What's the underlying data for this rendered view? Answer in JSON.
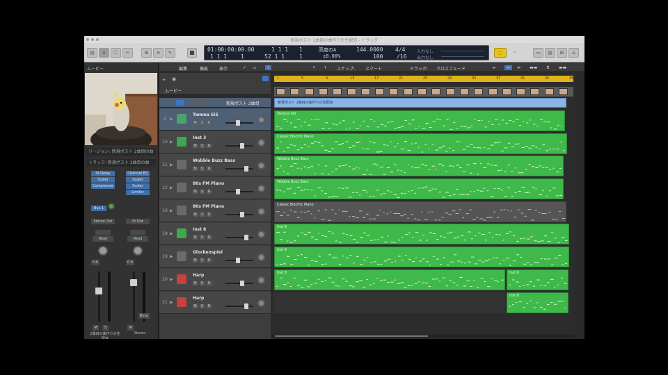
{
  "window": {
    "title": "新規ポスト 2曲目の曲作りの生配信 - トラック"
  },
  "control_bar": {
    "left_buttons": [
      "▤",
      "⬇",
      "ⓘ",
      "✂",
      "⊞",
      "≡",
      "✎"
    ],
    "right_buttons": [
      "▭",
      "▤",
      "⊞",
      "⌂"
    ],
    "lcd": {
      "smpte": "01:00:00:00.00",
      "bars_beats": "1 1 1",
      "bars_beats_tick": "1",
      "position_row2": "1 1 1",
      "position_row2_b": "1",
      "end_row2": "52 1 1",
      "end_row2_b": "1",
      "key_label": "高度のA",
      "key_value": "±0.00%",
      "tempo": "144.0000",
      "tempo_row2": "100",
      "signature": "4/4",
      "division": "/16",
      "input_label": "入力なし",
      "output_label": "出力なし"
    },
    "cycle_icon": "cycle-icon"
  },
  "inspector": {
    "header": "ムービー",
    "region_row": "リージョン: 新規ポスト 2曲目の曲",
    "track_row": "トラック: 新規ポスト 2曲目の曲",
    "strip_left": {
      "slots": [
        "St-Delay",
        "Scaler",
        "Compressor"
      ],
      "send": "Bus 1",
      "output": "Stereo Out",
      "mode": "Read",
      "db": "0.0",
      "name": "2曲目の曲作りの生配信"
    },
    "strip_right": {
      "slots": [
        "Channel EQ",
        "Scaler",
        "Scaler",
        "Limiter"
      ],
      "output": "St Out",
      "mode": "Read",
      "db": "0.0",
      "bounce": "Bnce",
      "name": "Stereo"
    }
  },
  "toolbar": {
    "items": [
      "編集",
      "機能",
      "表示"
    ],
    "snap_label": "スナップ:",
    "snap_value": "スマート",
    "drag_label": "ドラッグ:",
    "drag_value": "クロスフェード"
  },
  "global_tracks": {
    "label": "ムービー",
    "row_name": "新規ポスト 2曲目"
  },
  "tracks": [
    {
      "num": "2",
      "name": "Tamma SiS",
      "color": "#4aa36b",
      "selected": true
    },
    {
      "num": "10",
      "name": "Inst 3",
      "color": "#3fa84d",
      "selected": false
    },
    {
      "num": "11",
      "name": "Wobble Buzz Bass",
      "color": "#6a6a6a",
      "selected": false
    },
    {
      "num": "12",
      "name": "80s FM Piano",
      "color": "#6a6a6a",
      "selected": false
    },
    {
      "num": "16",
      "name": "80s FM Piano",
      "color": "#6a6a6a",
      "selected": false
    },
    {
      "num": "18",
      "name": "Inst 8",
      "color": "#3fa84d",
      "selected": false
    },
    {
      "num": "19",
      "name": "Glockenspiel",
      "color": "#6a6a6a",
      "selected": false
    },
    {
      "num": "20",
      "name": "Harp",
      "color": "#c84040",
      "selected": false
    },
    {
      "num": "21",
      "name": "Harp",
      "color": "#c84040",
      "selected": false
    }
  ],
  "ruler": {
    "ticks": [
      "1",
      "5",
      "9",
      "13",
      "17",
      "21",
      "25",
      "29",
      "33",
      "37",
      "41",
      "45",
      "49"
    ]
  },
  "video_region": {
    "label": "新規ポスト 2曲目の曲作りの生配信"
  },
  "regions": [
    {
      "name": "Tamma SiS"
    },
    {
      "name": "Classic Electric Piano"
    },
    {
      "name": "Wobble Buzz Bass"
    },
    {
      "name": "Wobble Buzz Bass"
    },
    {
      "name": "Classic Electric Piano"
    },
    {
      "name": "Inst 8"
    },
    {
      "name": "Inst 8"
    },
    {
      "name": "Inst 8"
    },
    {
      "name": "Inst 8"
    },
    {
      "name": "Inst 8"
    }
  ],
  "colors": {
    "region_green": "#3fb94a",
    "ruler_yellow": "#e0b21b",
    "video_blue": "#8db4e5"
  }
}
